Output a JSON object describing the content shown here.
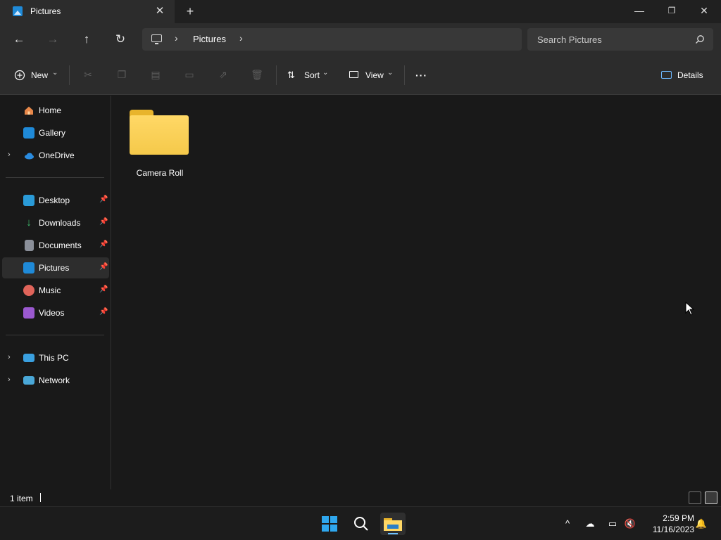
{
  "window": {
    "tab_title": "Pictures",
    "tab_close": "✕",
    "new_tab": "+",
    "minimize": "—",
    "maximize": "❐",
    "close": "✕"
  },
  "address": {
    "back": "←",
    "forward": "→",
    "up": "↑",
    "refresh": "↻",
    "crumb_sep": "›",
    "crumb": "Pictures",
    "search_placeholder": "Search Pictures"
  },
  "toolbar": {
    "new_label": "New",
    "sort_label": "Sort",
    "view_label": "View",
    "more_label": "···",
    "details_label": "Details",
    "chevron": "⌄"
  },
  "sidebar": {
    "top": [
      {
        "label": "Home",
        "icon": "home-icon"
      },
      {
        "label": "Gallery",
        "icon": "gallery-icon"
      },
      {
        "label": "OneDrive",
        "icon": "onedrive-icon"
      }
    ],
    "pinned": [
      {
        "label": "Desktop",
        "icon": "desktop-icon"
      },
      {
        "label": "Downloads",
        "icon": "downloads-icon"
      },
      {
        "label": "Documents",
        "icon": "documents-icon"
      },
      {
        "label": "Pictures",
        "icon": "pictures-icon",
        "selected": true
      },
      {
        "label": "Music",
        "icon": "music-icon"
      },
      {
        "label": "Videos",
        "icon": "videos-icon"
      }
    ],
    "bottom": [
      {
        "label": "This PC",
        "icon": "this-pc-icon"
      },
      {
        "label": "Network",
        "icon": "network-icon"
      }
    ],
    "chevron": "›",
    "pin": "📌"
  },
  "content": {
    "items": [
      {
        "name": "Camera Roll",
        "type": "folder"
      }
    ]
  },
  "status": {
    "item_count": "1 item"
  },
  "taskbar": {
    "time": "2:59 PM",
    "date": "11/16/2023",
    "tray_expand": "^"
  },
  "colors": {
    "background": "#191919",
    "chrome": "#2c2c2c",
    "folder": "#f5c94a",
    "accent": "#1f8ad8"
  }
}
